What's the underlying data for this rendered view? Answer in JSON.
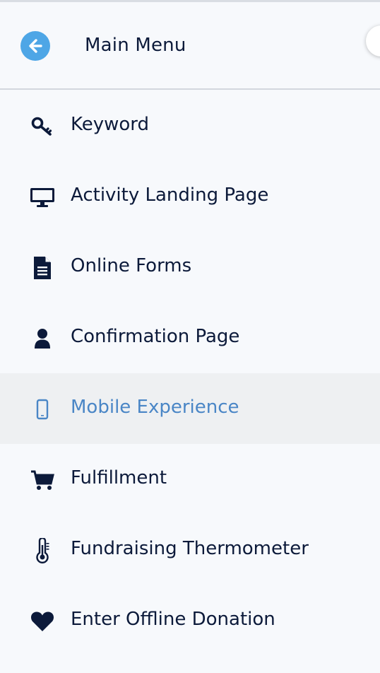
{
  "header": {
    "title": "Main Menu",
    "back_icon": "arrow-left-circle-icon"
  },
  "colors": {
    "accent": "#4ea6e6",
    "active_text": "#4a86c6",
    "text": "#0c1a3a",
    "active_bg": "#eef0f2"
  },
  "menu": {
    "items": [
      {
        "label": "Keyword",
        "icon": "key-icon",
        "active": false
      },
      {
        "label": "Activity Landing Page",
        "icon": "desktop-icon",
        "active": false
      },
      {
        "label": "Online Forms",
        "icon": "document-icon",
        "active": false
      },
      {
        "label": "Confirmation Page",
        "icon": "user-icon",
        "active": false
      },
      {
        "label": "Mobile Experience",
        "icon": "mobile-phone-icon",
        "active": true
      },
      {
        "label": "Fulfillment",
        "icon": "shopping-cart-icon",
        "active": false
      },
      {
        "label": "Fundraising Thermometer",
        "icon": "thermometer-icon",
        "active": false
      },
      {
        "label": "Enter Offline Donation",
        "icon": "heart-icon",
        "active": false
      }
    ]
  }
}
